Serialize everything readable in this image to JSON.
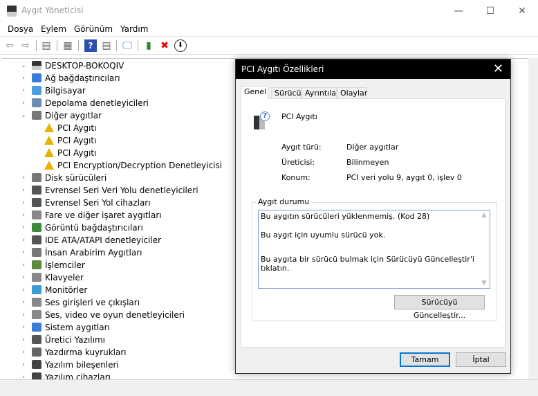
{
  "window": {
    "title": "Aygıt Yöneticisi",
    "minimize": "—",
    "maximize": "☐",
    "close": "✕"
  },
  "menu": [
    "Dosya",
    "Eylem",
    "Görünüm",
    "Yardım"
  ],
  "toolbar": [
    "back-icon",
    "forward-icon",
    "properties-panel-icon",
    "properties-icon",
    "help-icon",
    "update-driver-icon",
    "scan-hardware-icon",
    "enable-device-icon",
    "uninstall-icon",
    "download-icon"
  ],
  "tree": {
    "root": "DESKTOP-BOKOQIV",
    "items": [
      {
        "label": "Ağ bağdaştırıcıları",
        "level": 1,
        "color": "#3a7bd5"
      },
      {
        "label": "Bilgisayar",
        "level": 1,
        "color": "#4a9ee0"
      },
      {
        "label": "Depolama denetleyicileri",
        "level": 1,
        "color": "#6a8fb0"
      },
      {
        "label": "Diğer aygıtlar",
        "level": 1,
        "color": "#777",
        "expanded": true
      },
      {
        "label": "PCI Aygıtı",
        "level": 2,
        "color": "#e8b000"
      },
      {
        "label": "PCI Aygıtı",
        "level": 2,
        "color": "#e8b000"
      },
      {
        "label": "PCI Aygıtı",
        "level": 2,
        "color": "#e8b000"
      },
      {
        "label": "PCI Encryption/Decryption Denetleyicisi",
        "level": 2,
        "color": "#e8b000"
      },
      {
        "label": "Disk sürücüleri",
        "level": 1,
        "color": "#777"
      },
      {
        "label": "Evrensel Seri Veri Yolu denetleyicileri",
        "level": 1,
        "color": "#555"
      },
      {
        "label": "Evrensel Seri Yol cihazları",
        "level": 1,
        "color": "#555"
      },
      {
        "label": "Fare ve diğer işaret aygıtları",
        "level": 1,
        "color": "#888"
      },
      {
        "label": "Görüntü bağdaştırıcıları",
        "level": 1,
        "color": "#3a8a3a"
      },
      {
        "label": "IDE ATA/ATAPI denetleyiciler",
        "level": 1,
        "color": "#555"
      },
      {
        "label": "İnsan Arabirim Aygıtları",
        "level": 1,
        "color": "#777"
      },
      {
        "label": "İşlemciler",
        "level": 1,
        "color": "#5a8a3a"
      },
      {
        "label": "Klavyeler",
        "level": 1,
        "color": "#888"
      },
      {
        "label": "Monitörler",
        "level": 1,
        "color": "#3a9ad5"
      },
      {
        "label": "Ses girişleri ve çıkışları",
        "level": 1,
        "color": "#888"
      },
      {
        "label": "Ses, video ve oyun denetleyicileri",
        "level": 1,
        "color": "#888"
      },
      {
        "label": "Sistem aygıtları",
        "level": 1,
        "color": "#3a7bd5"
      },
      {
        "label": "Üretici Yazılımı",
        "level": 1,
        "color": "#555"
      },
      {
        "label": "Yazdırma kuyrukları",
        "level": 1,
        "color": "#666"
      },
      {
        "label": "Yazılım bileşenleri",
        "level": 1,
        "color": "#444"
      },
      {
        "label": "Yazılım cihazları",
        "level": 1,
        "color": "#444"
      }
    ]
  },
  "dialog": {
    "title": "PCI Aygıtı Özellikleri",
    "close": "✕",
    "tabs": [
      "Genel",
      "Sürücü",
      "Ayrıntılar",
      "Olaylar"
    ],
    "device_name": "PCI Aygıtı",
    "fields": [
      {
        "label": "Aygıt türü:",
        "value": "Diğer aygıtlar"
      },
      {
        "label": "Üreticisi:",
        "value": "Bilinmeyen"
      },
      {
        "label": "Konum:",
        "value": "PCI veri yolu 9, aygıt 0, işlev 0"
      }
    ],
    "status_group": "Aygıt durumu",
    "status_lines": [
      "Bu aygıtın sürücüleri yüklenmemiş. (Kod 28)",
      "Bu aygıt için uyumlu sürücü yok.",
      "Bu aygıta bir sürücü bulmak için Sürücüyü Güncelleştir'i tıklatın."
    ],
    "update_button": "Sürücüyü Güncelleştir...",
    "ok": "Tamam",
    "cancel": "İptal"
  }
}
